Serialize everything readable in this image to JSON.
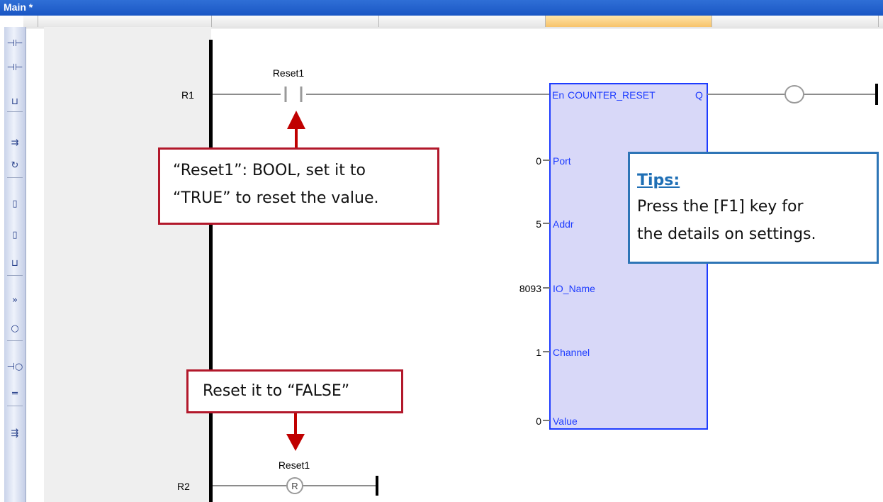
{
  "window": {
    "title": "Main *"
  },
  "toolbar": {
    "buttons": [
      {
        "name": "contact-before-button",
        "glyph": "⊣⊢"
      },
      {
        "name": "contact-after-button",
        "glyph": "⊣⊢"
      },
      {
        "name": "parallel-contact-button",
        "glyph": "⊔"
      },
      {
        "name": "insert-rung-button",
        "glyph": "⇉"
      },
      {
        "name": "invert-button",
        "glyph": "↻"
      },
      {
        "name": "block-before-button",
        "glyph": "▯"
      },
      {
        "name": "block-after-button",
        "glyph": "▯"
      },
      {
        "name": "parallel-block-button",
        "glyph": "⊔"
      },
      {
        "name": "jump-button",
        "glyph": "»"
      },
      {
        "name": "coil-button",
        "glyph": "○"
      },
      {
        "name": "rung-button",
        "glyph": "⊣○"
      },
      {
        "name": "horizontal-line-button",
        "glyph": "═"
      },
      {
        "name": "comment-button",
        "glyph": "⇶"
      }
    ]
  },
  "rungs": {
    "r1": {
      "label": "R1",
      "contact_variable": "Reset1"
    },
    "r2": {
      "label": "R2",
      "coil_variable": "Reset1",
      "coil_symbol": "R"
    }
  },
  "function_block": {
    "header_en": "En",
    "name": "COUNTER_RESET",
    "output": "Q",
    "inputs": [
      {
        "value": "0",
        "name": "Port"
      },
      {
        "value": "5",
        "name": "Addr"
      },
      {
        "value": "8093",
        "name": "IO_Name"
      },
      {
        "value": "1",
        "name": "Channel"
      },
      {
        "value": "0",
        "name": "Value"
      }
    ]
  },
  "callouts": {
    "reset_true_line1": "“Reset1”: BOOL, set it to",
    "reset_true_line2": "“TRUE” to reset the value.",
    "reset_false": "Reset it to “FALSE”",
    "tips_heading": "Tips:",
    "tips_line1": "Press the [F1] key for",
    "tips_line2": "the details on settings."
  },
  "colors": {
    "titlebar": "#1a56c4",
    "block_fill": "#d8d8f8",
    "block_border": "#1e3cff",
    "callout_red": "#b2182b",
    "callout_blue": "#2e75b6",
    "arrow_red": "#c00000"
  }
}
